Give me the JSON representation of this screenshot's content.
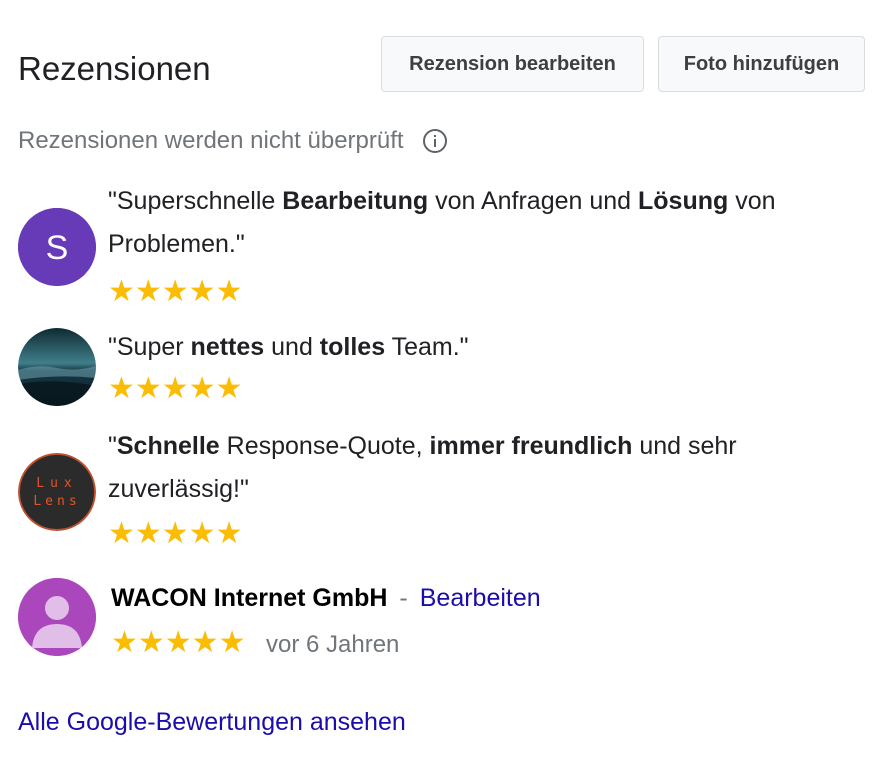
{
  "header": {
    "title": "Rezensionen",
    "edit_review_label": "Rezension bearbeiten",
    "add_photo_label": "Foto hinzufügen"
  },
  "disclaimer": {
    "text": "Rezensionen werden nicht überprüft",
    "icon": "info-icon"
  },
  "reviews": [
    {
      "avatar_letter": "S",
      "avatar_color": "#673ab7",
      "parts": [
        "\"Superschnelle ",
        "Bearbeitung",
        " von Anfragen und ",
        "Lösung",
        " von Problemen.\""
      ],
      "rating": 5,
      "stars": "★★★★★"
    },
    {
      "avatar_type": "photo-landscape",
      "parts": [
        "\"Super ",
        "nettes",
        " und ",
        "tolles",
        " Team.\""
      ],
      "rating": 5,
      "stars": "★★★★★"
    },
    {
      "avatar_type": "logo",
      "avatar_logo_text": "Lux Lens",
      "parts": [
        "\"",
        "Schnelle",
        " Response-Quote, ",
        "immer freundlich",
        " und sehr zuverlässig!\""
      ],
      "rating": 5,
      "stars": "★★★★★"
    }
  ],
  "own_review": {
    "author": "WACON Internet GmbH",
    "separator": "-",
    "edit_label": "Bearbeiten",
    "rating": 5,
    "stars": "★★★★★",
    "age": "vor 6 Jahren",
    "avatar_color": "#ab47bc"
  },
  "footer": {
    "all_reviews_label": "Alle Google-Bewertungen ansehen"
  },
  "colors": {
    "star": "#fbbc04",
    "link": "#1a0dab",
    "muted": "#70757a"
  }
}
